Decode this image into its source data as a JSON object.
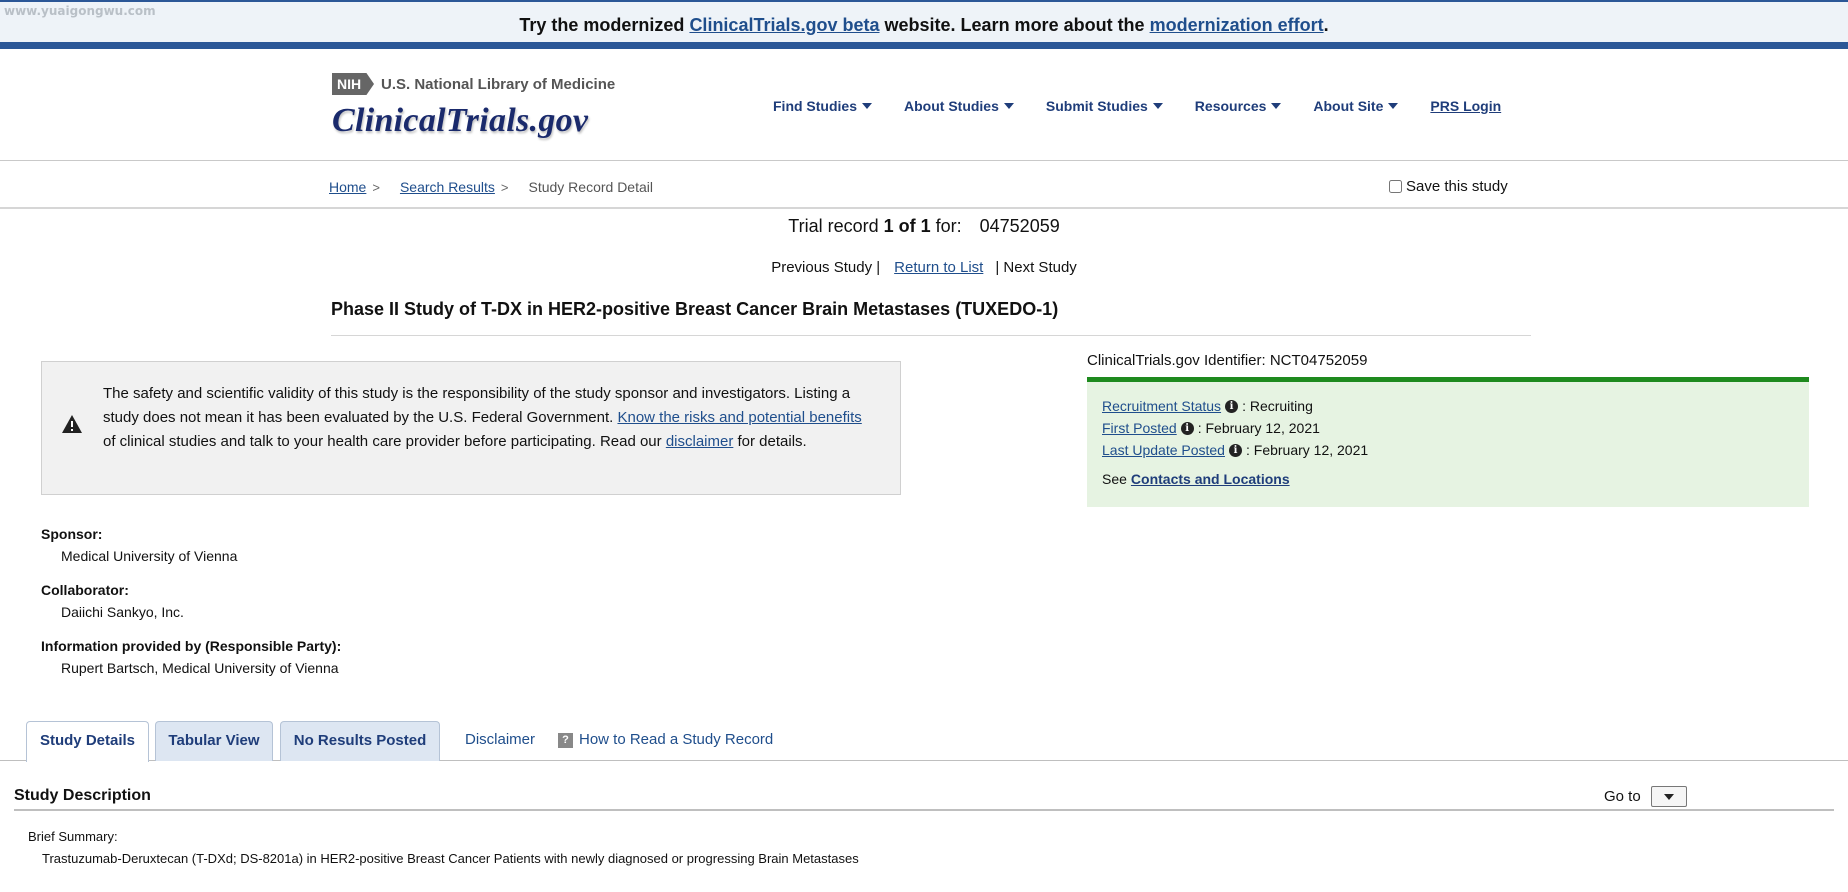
{
  "watermark": "www.yuaigongwu.com",
  "banner": {
    "prefix": "Try the modernized ",
    "link1": "ClinicalTrials.gov beta",
    "middle": " website. Learn more about the ",
    "link2": "modernization effort",
    "suffix": "."
  },
  "header": {
    "nih_badge": "NIH",
    "nlm_text": "U.S. National Library of Medicine",
    "logo": "ClinicalTrials.gov"
  },
  "nav": {
    "items": [
      {
        "label": "Find Studies"
      },
      {
        "label": "About Studies"
      },
      {
        "label": "Submit Studies"
      },
      {
        "label": "Resources"
      },
      {
        "label": "About Site"
      }
    ],
    "login": "PRS Login"
  },
  "breadcrumb": {
    "home": "Home",
    "search_results": "Search Results",
    "current": "Study Record Detail",
    "separator": ">"
  },
  "save_study": "Save this study",
  "trial_record": {
    "prefix": "Trial record ",
    "position": "1 of 1",
    "for_text": " for:",
    "record_id": "04752059"
  },
  "study_nav": {
    "previous": "Previous Study |",
    "return": "Return to List",
    "next": "| Next Study"
  },
  "study_title": "Phase II Study of T-DX in HER2-positive Breast Cancer Brain Metastases (TUXEDO-1)",
  "disclaimer": {
    "text1": "The safety and scientific validity of this study is the responsibility of the study sponsor and investigators. Listing a study does not mean it has been evaluated by the U.S. Federal Government. ",
    "link1": "Know the risks and potential benefits",
    "text2": " of clinical studies and talk to your health care provider before participating. Read our ",
    "link2": "disclaimer",
    "text3": " for details."
  },
  "identifier": "ClinicalTrials.gov Identifier: NCT04752059",
  "status": {
    "recruitment_label": "Recruitment Status",
    "recruitment_value": ": Recruiting",
    "first_posted_label": "First Posted",
    "first_posted_value": ": February 12, 2021",
    "last_update_label": "Last Update Posted",
    "last_update_value": ": February 12, 2021",
    "see_text": "See",
    "contacts_link": "Contacts and Locations",
    "accent_color": "#1e8a1e"
  },
  "sponsor": {
    "sponsor_label": "Sponsor:",
    "sponsor_value": "Medical University of Vienna",
    "collaborator_label": "Collaborator:",
    "collaborator_value": "Daiichi Sankyo, Inc.",
    "responsible_label": "Information provided by (Responsible Party):",
    "responsible_value": "Rupert Bartsch, Medical University of Vienna"
  },
  "tabs": {
    "study_details": "Study Details",
    "tabular_view": "Tabular View",
    "no_results": "No Results Posted",
    "disclaimer": "Disclaimer",
    "how_to_read": "How to Read a Study Record",
    "help_glyph": "?"
  },
  "description": {
    "heading": "Study Description",
    "goto_label": "Go to",
    "brief_label": "Brief Summary:",
    "brief_text": "Trastuzumab-Deruxtecan (T-DXd; DS-8201a) in HER2-positive Breast Cancer Patients with newly diagnosed or progressing Brain Metastases"
  }
}
